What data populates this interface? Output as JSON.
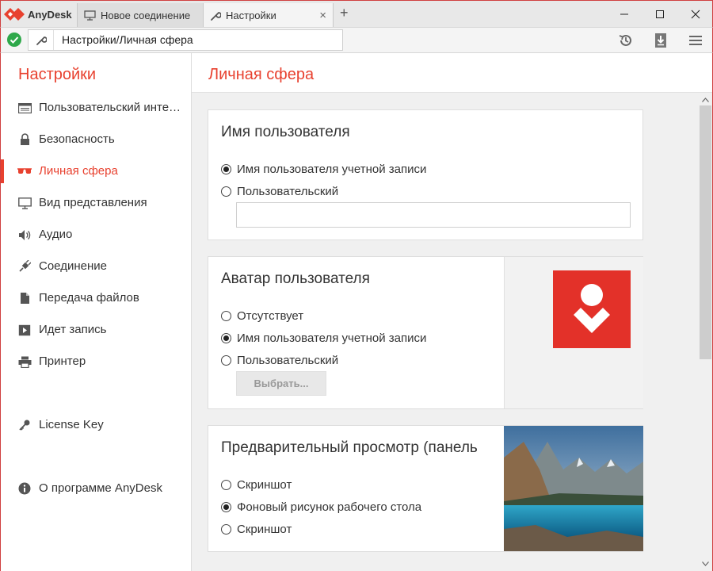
{
  "app": {
    "brand": "AnyDesk",
    "brand_color": "#e8412f"
  },
  "tabs": [
    {
      "label": "Новое соединение",
      "icon": "monitor-icon"
    },
    {
      "label": "Настройки",
      "icon": "wrench-icon",
      "close": "×"
    }
  ],
  "titlebar": {
    "new_tab": "+"
  },
  "address": {
    "value": "Настройки/Личная сфера",
    "status_icon": "check-circle-icon"
  },
  "sidebar": {
    "title": "Настройки",
    "items": [
      {
        "label": "Пользовательский интерфейс",
        "icon": "window-icon"
      },
      {
        "label": "Безопасность",
        "icon": "lock-icon"
      },
      {
        "label": "Личная сфера",
        "icon": "glasses-icon",
        "active": true
      },
      {
        "label": "Вид представления",
        "icon": "monitor-icon"
      },
      {
        "label": "Аудио",
        "icon": "speaker-icon"
      },
      {
        "label": "Соединение",
        "icon": "plug-icon"
      },
      {
        "label": "Передача файлов",
        "icon": "file-icon"
      },
      {
        "label": "Идет запись",
        "icon": "play-icon"
      },
      {
        "label": "Принтер",
        "icon": "printer-icon"
      },
      {
        "label": "License Key",
        "icon": "key-icon"
      },
      {
        "label": "О программе AnyDesk",
        "icon": "info-icon"
      }
    ]
  },
  "main": {
    "title": "Личная сфера",
    "username_card": {
      "title": "Имя пользователя",
      "options": [
        "Имя пользователя учетной записи",
        "Пользовательский"
      ],
      "selected": 0,
      "custom_value": ""
    },
    "avatar_card": {
      "title": "Аватар пользователя",
      "options": [
        "Отсутствует",
        "Имя пользователя учетной записи",
        "Пользовательский"
      ],
      "selected": 1,
      "choose_button": "Выбрать..."
    },
    "preview_card": {
      "title": "Предварительный просмотр (панель",
      "options": [
        "Скриншот",
        "Фоновый рисунок рабочего стола",
        "Скриншот"
      ],
      "selected": 1
    }
  }
}
